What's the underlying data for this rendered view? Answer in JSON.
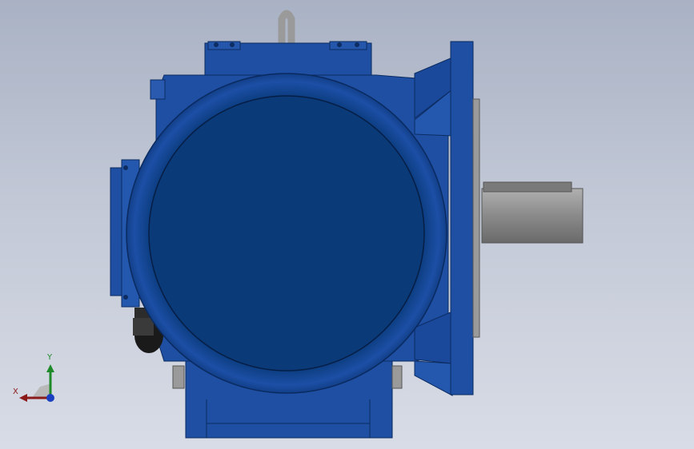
{
  "viewport": {
    "background_top": "#a9b2c4",
    "background_bottom": "#d8dce6"
  },
  "model": {
    "body_color": "#1e4fa3",
    "dark_blue": "#0a3a78",
    "shaft_color": "#8c8c8c",
    "parts": [
      "lifting-eye",
      "gearbox-housing",
      "motor-end-cover",
      "output-flange",
      "output-shaft",
      "terminal-box",
      "cable-gland",
      "mounting-foot"
    ]
  },
  "triad": {
    "x_label": "X",
    "y_label": "Y",
    "x_color": "#8b1a1a",
    "y_color": "#1f8a2a",
    "z_color": "#1a3fc0"
  }
}
